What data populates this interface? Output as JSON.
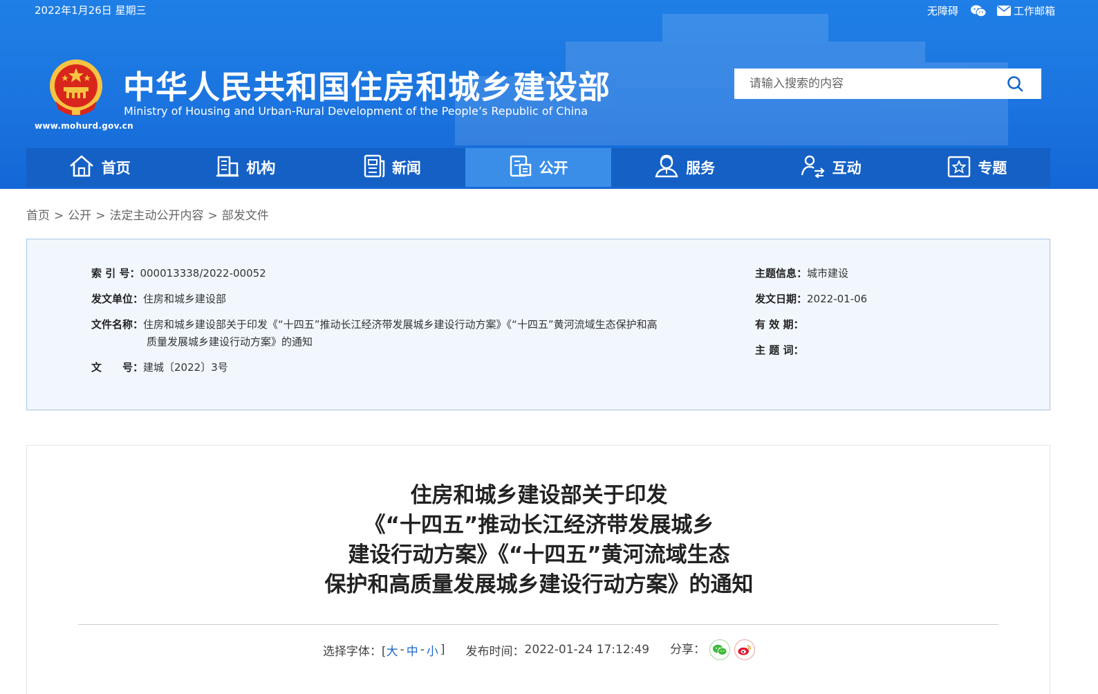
{
  "top": {
    "date": "2022年1月26日 星期三",
    "links": [
      {
        "label": "无障碍",
        "icon": ""
      },
      {
        "label": "",
        "icon": "wechat-icon"
      },
      {
        "label": "工作邮箱",
        "icon": "mail-icon"
      }
    ]
  },
  "site": {
    "url": "www.mohurd.gov.cn",
    "title_cn": "中华人民共和国住房和城乡建设部",
    "title_en": "Ministry of Housing and Urban-Rural Development of the People’s Republic of China"
  },
  "search": {
    "placeholder": "请输入搜索的内容"
  },
  "nav": [
    {
      "label": "首页",
      "icon": "home-icon",
      "active": false
    },
    {
      "label": "机构",
      "icon": "building-icon",
      "active": false
    },
    {
      "label": "新闻",
      "icon": "news-icon",
      "active": false
    },
    {
      "label": "公开",
      "icon": "document-icon",
      "active": true
    },
    {
      "label": "服务",
      "icon": "service-icon",
      "active": false
    },
    {
      "label": "互动",
      "icon": "interaction-icon",
      "active": false
    },
    {
      "label": "专题",
      "icon": "star-icon",
      "active": false
    }
  ],
  "breadcrumb": [
    "首页",
    "公开",
    "法定主动公开内容",
    "部发文件"
  ],
  "meta": {
    "index_label": "索 引 号：",
    "index_value": "000013338/2022-00052",
    "unit_label": "发文单位：",
    "unit_value": "住房和城乡建设部",
    "name_label": "文件名称：",
    "name_value_line1": "住房和城乡建设部关于印发《“十四五”推动长江经济带发展城乡建设行动方案》《“十四五”黄河流域生态保护和高",
    "name_value_line2": "质量发展城乡建设行动方案》的通知",
    "docno_label": "文　　号：",
    "docno_value": "建城〔2022〕3号",
    "topic_label": "主题信息：",
    "topic_value": "城市建设",
    "date_label": "发文日期：",
    "date_value": "2022-01-06",
    "valid_label": "有 效 期：",
    "keywords_label": "主 题 词："
  },
  "doc": {
    "title_lines": [
      "住房和城乡建设部关于印发",
      "《“十四五”推动长江经济带发展城乡",
      "建设行动方案》《“十四五”黄河流域生态",
      "保护和高质量发展城乡建设行动方案》的通知"
    ],
    "font_label": "选择字体：[",
    "font_large": "大",
    "font_medium": "中",
    "font_small": "小",
    "font_dash": "-",
    "font_close": "]",
    "publish_label": "发布时间：",
    "publish_value": "2022-01-24 17:12:49",
    "share_label": "分享：",
    "share_icons": [
      "wechat-share-icon",
      "weibo-share-icon"
    ]
  },
  "colors": {
    "header": "#1b74df",
    "nav": "#1460c5",
    "nav_active": "#3a8ee8",
    "link": "#1a66cc",
    "meta_bg": "#f2f7fd"
  }
}
